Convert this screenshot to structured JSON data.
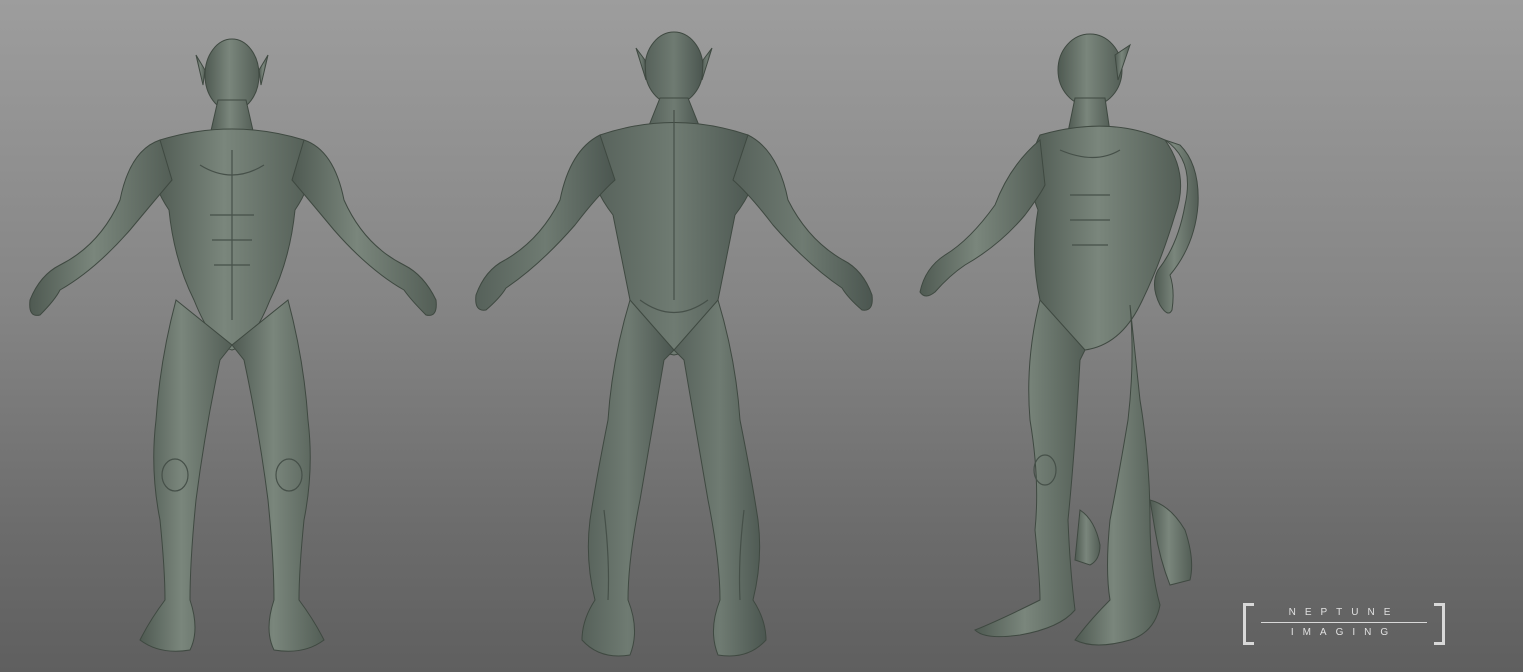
{
  "scene": {
    "background_top": "#9d9d9d",
    "background_bottom": "#5f5f5f",
    "model_color": "#6e7a70",
    "model_shadow": "#4a544c",
    "model_highlight": "#8e9a90",
    "views": [
      "front",
      "back",
      "three-quarter"
    ]
  },
  "watermark": {
    "line1": "NEPTUNE",
    "line2": "IMAGING",
    "color": "#d8d8d8"
  }
}
